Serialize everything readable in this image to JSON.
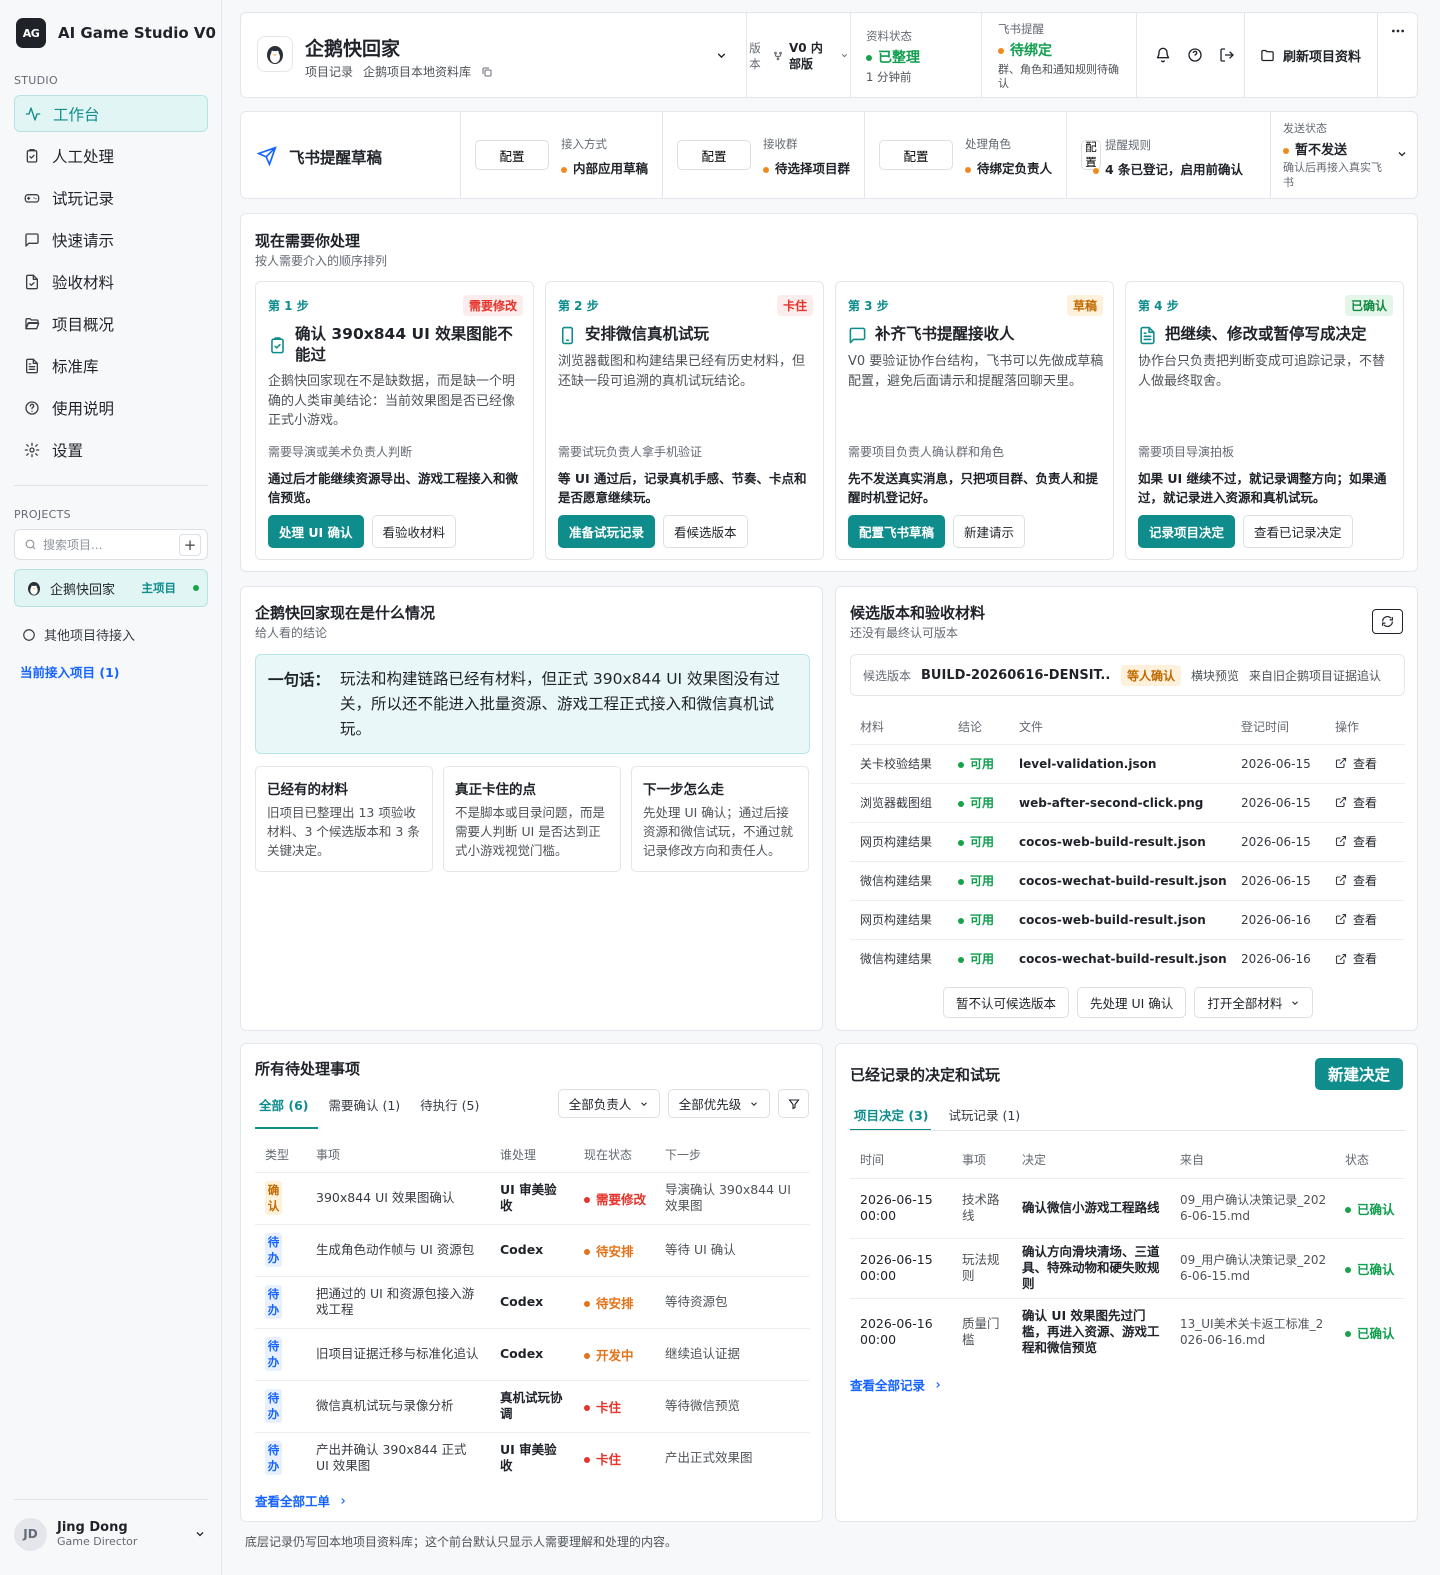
{
  "app": {
    "logo": "AG",
    "name": "AI Game Studio V0"
  },
  "sidebar": {
    "studio_label": "STUDIO",
    "nav": [
      {
        "label": "工作台",
        "icon": "activity-icon",
        "active": true
      },
      {
        "label": "人工处理",
        "icon": "clipboard-check-icon"
      },
      {
        "label": "试玩记录",
        "icon": "gamepad-icon"
      },
      {
        "label": "快速请示",
        "icon": "message-square-icon"
      },
      {
        "label": "验收材料",
        "icon": "file-check-icon"
      },
      {
        "label": "项目概况",
        "icon": "folder-open-icon"
      },
      {
        "label": "标准库",
        "icon": "file-text-icon"
      },
      {
        "label": "使用说明",
        "icon": "help-circle-icon"
      },
      {
        "label": "设置",
        "icon": "gear-icon"
      }
    ],
    "projects_label": "PROJECTS",
    "search_placeholder": "搜索项目...",
    "add_label": "+",
    "project": {
      "name": "企鹅快回家",
      "tag": "主项目"
    },
    "other_project": "其他项目待接入",
    "current_link": "当前接入项目 (1)",
    "user": {
      "initials": "JD",
      "name": "Jing Dong",
      "role": "Game Director"
    }
  },
  "header": {
    "project_name": "企鹅快回家",
    "crumb1": "项目记录",
    "crumb2": "企鹅项目本地资料库",
    "version_label": "版本",
    "version_value": "V0 内部版",
    "data_status_label": "资料状态",
    "data_status_value": "已整理",
    "data_status_time": "1 分钟前",
    "lark_label": "飞书提醒",
    "lark_value": "待绑定",
    "lark_note": "群、角色和通知规则待确认",
    "refresh_label": "刷新项目资料"
  },
  "lark_bar": {
    "title": "飞书提醒草稿",
    "configure_label": "配置",
    "items": [
      {
        "label": "接入方式",
        "value": "内部应用草稿"
      },
      {
        "label": "接收群",
        "value": "待选择项目群"
      },
      {
        "label": "处理角色",
        "value": "待绑定负责人"
      },
      {
        "label": "提醒规则",
        "value": "4 条已登记，启用前确认"
      }
    ],
    "send_label": "发送状态",
    "send_value": "暂不发送",
    "send_note": "确认后再接入真实飞书"
  },
  "todo": {
    "title": "现在需要你处理",
    "subtitle": "按人需要介入的顺序排列",
    "steps": [
      {
        "no": "第 1 步",
        "badge": "需要修改",
        "badge_color": "#e5342b",
        "badge_bg": "#fdecec",
        "icon": "clipboard-check-icon",
        "title": "确认 390x844 UI 效果图能不能过",
        "desc": "企鹅快回家现在不是缺数据，而是缺一个明确的人类审美结论：当前效果图是否已经像正式小游戏。",
        "who": "需要导演或美术负责人判断",
        "next": "通过后才能继续资源导出、游戏工程接入和微信预览。",
        "primary": "处理 UI 确认",
        "secondary": "看验收材料"
      },
      {
        "no": "第 2 步",
        "badge": "卡住",
        "badge_color": "#e5342b",
        "badge_bg": "#fdecec",
        "icon": "smartphone-icon",
        "title": "安排微信真机试玩",
        "desc": "浏览器截图和构建结果已经有历史材料，但还缺一段可追溯的真机试玩结论。",
        "who": "需要试玩负责人拿手机验证",
        "next": "等 UI 通过后，记录真机手感、节奏、卡点和是否愿意继续玩。",
        "primary": "准备试玩记录",
        "secondary": "看候选版本"
      },
      {
        "no": "第 3 步",
        "badge": "草稿",
        "badge_color": "#c26a00",
        "badge_bg": "#fdf1dc",
        "icon": "message-square-icon",
        "title": "补齐飞书提醒接收人",
        "desc": "V0 要验证协作台结构，飞书可以先做成草稿配置，避免后面请示和提醒落回聊天里。",
        "who": "需要项目负责人确认群和角色",
        "next": "先不发送真实消息，只把项目群、负责人和提醒时机登记好。",
        "primary": "配置飞书草稿",
        "secondary": "新建请示"
      },
      {
        "no": "第 4 步",
        "badge": "已确认",
        "badge_color": "#0f8a3f",
        "badge_bg": "#e4f6ea",
        "icon": "file-text-icon",
        "title": "把继续、修改或暂停写成决定",
        "desc": "协作台只负责把判断变成可追踪记录，不替人做最终取舍。",
        "who": "需要项目导演拍板",
        "next": "如果 UI 继续不过，就记录调整方向；如果通过，就记录进入资源和真机试玩。",
        "primary": "记录项目决定",
        "secondary": "查看已记录决定"
      }
    ]
  },
  "situation": {
    "title": "企鹅快回家现在是什么情况",
    "subtitle": "给人看的结论",
    "summary_label": "一句话：",
    "summary_text": "玩法和构建链路已经有材料，但正式 390x844 UI 效果图没有过关，所以还不能进入批量资源、游戏工程正式接入和微信真机试玩。",
    "boxes": [
      {
        "title": "已经有的材料",
        "text": "旧项目已整理出 13 项验收材料、3 个候选版本和 3 条关键决定。"
      },
      {
        "title": "真正卡住的点",
        "text": "不是脚本或目录问题，而是需要人判断 UI 是否达到正式小游戏视觉门槛。"
      },
      {
        "title": "下一步怎么走",
        "text": "先处理 UI 确认；通过后接资源和微信试玩，不通过就记录修改方向和责任人。"
      }
    ]
  },
  "candidates": {
    "title": "候选版本和验收材料",
    "subtitle": "还没有最终认可版本",
    "version_label": "候选版本",
    "build": "BUILD-20260616-DENSIT...",
    "build_badge": "等人确认",
    "build_type": "横块预览",
    "build_source": "来自旧企鹅项目证据追认",
    "columns": [
      "材料",
      "结论",
      "文件",
      "登记时间",
      "操作"
    ],
    "rows": [
      {
        "material": "关卡校验结果",
        "result": "可用",
        "file": "level-validation.json",
        "date": "2026-06-15",
        "action": "查看"
      },
      {
        "material": "浏览器截图组",
        "result": "可用",
        "file": "web-after-second-click.png",
        "date": "2026-06-15",
        "action": "查看"
      },
      {
        "material": "网页构建结果",
        "result": "可用",
        "file": "cocos-web-build-result.json",
        "date": "2026-06-15",
        "action": "查看"
      },
      {
        "material": "微信构建结果",
        "result": "可用",
        "file": "cocos-wechat-build-result.json",
        "date": "2026-06-15",
        "action": "查看"
      },
      {
        "material": "网页构建结果",
        "result": "可用",
        "file": "cocos-web-build-result.json",
        "date": "2026-06-16",
        "action": "查看"
      },
      {
        "material": "微信构建结果",
        "result": "可用",
        "file": "cocos-wechat-build-result.json",
        "date": "2026-06-16",
        "action": "查看"
      }
    ],
    "btn_reject": "暂不认可候选版本",
    "btn_ui": "先处理 UI 确认",
    "btn_open": "打开全部材料"
  },
  "pending": {
    "title": "所有待处理事项",
    "tabs": [
      "全部 (6)",
      "需要确认 (1)",
      "待执行 (5)"
    ],
    "filter_owner": "全部负责人",
    "filter_priority": "全部优先级",
    "columns": [
      "类型",
      "事项",
      "谁处理",
      "现在状态",
      "下一步"
    ],
    "rows": [
      {
        "type": "确认",
        "type_color": "#c26a00",
        "type_bg": "#fdf1dc",
        "item": "390x844 UI 效果图确认",
        "who": "UI 审美验收",
        "status": "需要修改",
        "status_color": "#e5342b",
        "next": "导演确认 390x844 UI 效果图"
      },
      {
        "type": "待办",
        "type_color": "#1664ff",
        "type_bg": "#e8f0ff",
        "item": "生成角色动作帧与 UI 资源包",
        "who": "Codex",
        "status": "待安排",
        "status_color": "#e37318",
        "next": "等待 UI 确认"
      },
      {
        "type": "待办",
        "type_color": "#1664ff",
        "type_bg": "#e8f0ff",
        "item": "把通过的 UI 和资源包接入游戏工程",
        "who": "Codex",
        "status": "待安排",
        "status_color": "#e37318",
        "next": "等待资源包"
      },
      {
        "type": "待办",
        "type_color": "#1664ff",
        "type_bg": "#e8f0ff",
        "item": "旧项目证据迁移与标准化追认",
        "who": "Codex",
        "status": "开发中",
        "status_color": "#e37318",
        "next": "继续追认证据"
      },
      {
        "type": "待办",
        "type_color": "#1664ff",
        "type_bg": "#e8f0ff",
        "item": "微信真机试玩与录像分析",
        "who": "真机试玩协调",
        "status": "卡住",
        "status_color": "#e5342b",
        "next": "等待微信预览"
      },
      {
        "type": "待办",
        "type_color": "#1664ff",
        "type_bg": "#e8f0ff",
        "item": "产出并确认 390x844 正式 UI 效果图",
        "who": "UI 审美验收",
        "status": "卡住",
        "status_color": "#e5342b",
        "next": "产出正式效果图"
      }
    ],
    "view_all": "查看全部工单"
  },
  "decisions": {
    "title": "已经记录的决定和试玩",
    "new_label": "新建决定",
    "tabs": [
      "项目决定 (3)",
      "试玩记录 (1)"
    ],
    "columns": [
      "时间",
      "事项",
      "决定",
      "来自",
      "状态"
    ],
    "rows": [
      {
        "time": "2026-06-15 00:00",
        "item": "技术路线",
        "decision": "确认微信小游戏工程路线",
        "source": "09_用户确认决策记录_2026-06-15.md",
        "status": "已确认"
      },
      {
        "time": "2026-06-15 00:00",
        "item": "玩法规则",
        "decision": "确认方向滑块清场、三道具、特殊动物和硬失败规则",
        "source": "09_用户确认决策记录_2026-06-15.md",
        "status": "已确认"
      },
      {
        "time": "2026-06-16 00:00",
        "item": "质量门槛",
        "decision": "确认 UI 效果图先过门槛，再进入资源、游戏工程和微信预览",
        "source": "13_UI美术关卡返工标准_2026-06-16.md",
        "status": "已确认"
      }
    ],
    "view_all": "查看全部记录"
  },
  "footer": "底层记录仍写回本地项目资料库；这个前台默认只显示人需要理解和处理的内容。",
  "colors": {
    "accent": "#0f8c8c",
    "link": "#1664ff",
    "ok": "#16a34a",
    "warn": "#f08a1c",
    "bad": "#e5342b"
  }
}
